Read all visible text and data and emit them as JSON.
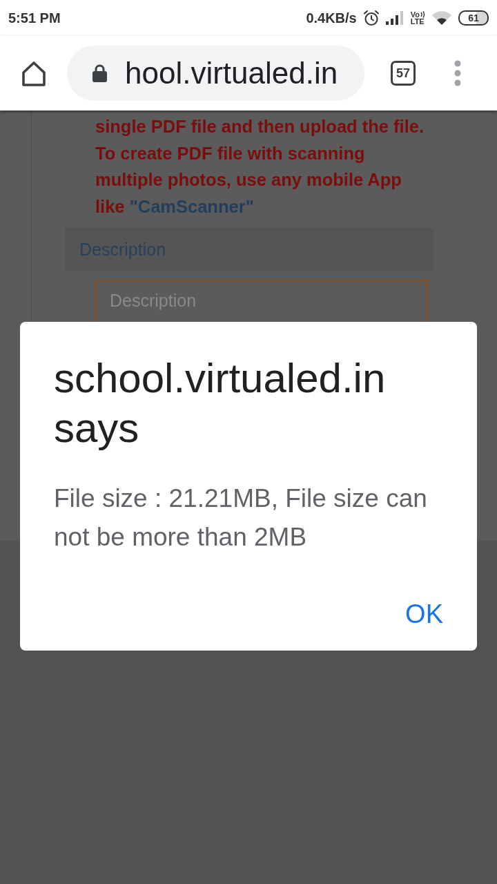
{
  "status_bar": {
    "time": "5:51 PM",
    "speed": "0.4KB/s",
    "volte_top": "Vo",
    "volte_bottom": "LTE",
    "battery": "61"
  },
  "toolbar": {
    "url": "hool.virtualed.in",
    "tab_count": "57"
  },
  "page": {
    "notice": {
      "text": "single PDF file and then upload the file. To create PDF file with scanning multiple photos, use any mobile App like",
      "link": "\"CamScanner\""
    },
    "section_header": "Description",
    "description_field": {
      "placeholder": "Description"
    }
  },
  "dialog": {
    "title": "school.virtualed.in says",
    "message": "File size : 21.21MB, File size can not be more than 2MB",
    "buttons": [
      "OK"
    ]
  }
}
